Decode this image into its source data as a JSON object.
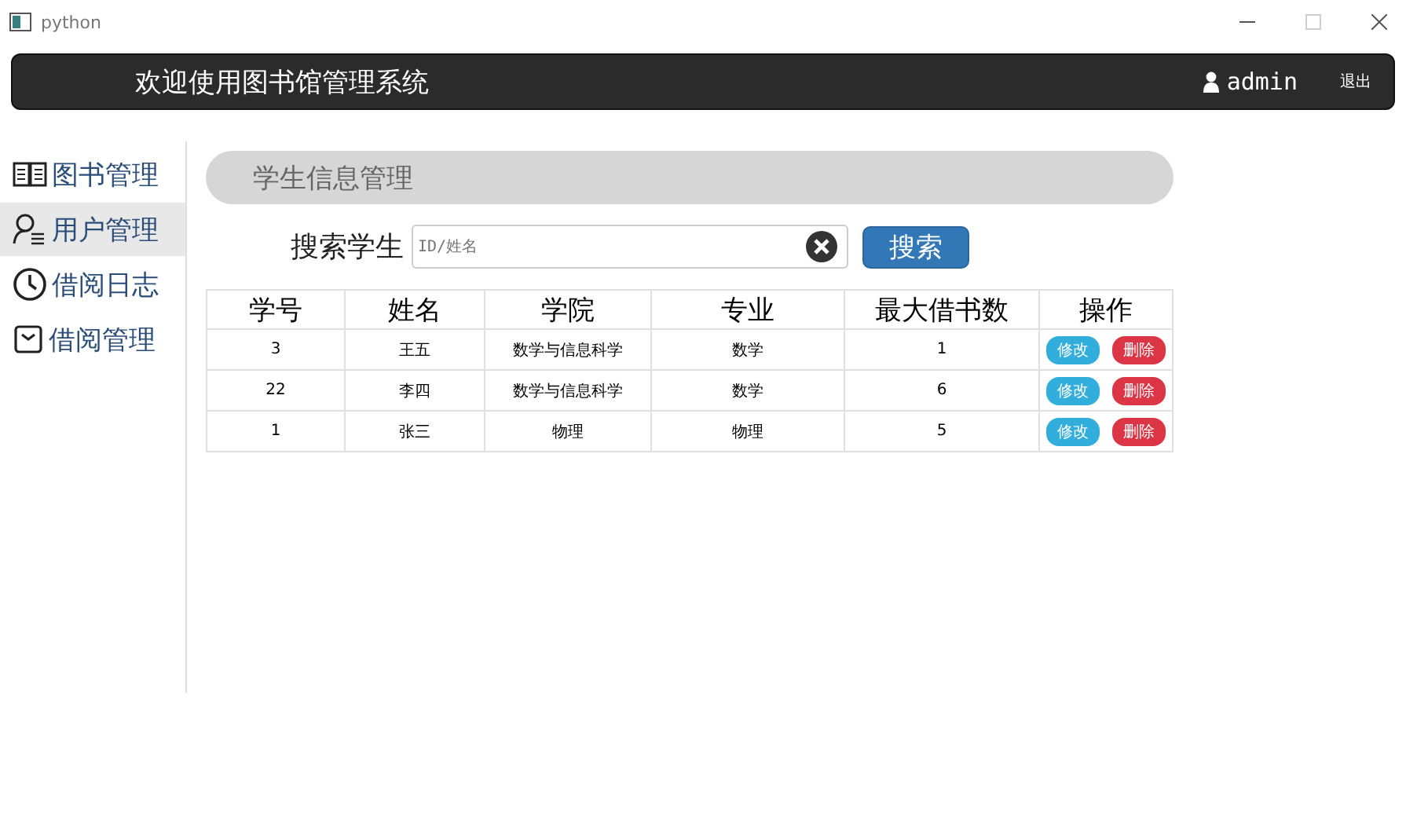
{
  "window": {
    "title": "python"
  },
  "header": {
    "title": "欢迎使用图书馆管理系统",
    "user": "admin",
    "logout": "退出"
  },
  "sidebar": {
    "items": [
      {
        "kind": "book",
        "label": "图书管理",
        "selected": false
      },
      {
        "kind": "user",
        "label": "用户管理",
        "selected": true
      },
      {
        "kind": "clock",
        "label": "借阅日志",
        "selected": false
      },
      {
        "kind": "tray",
        "label": "借阅管理",
        "selected": false
      }
    ]
  },
  "panel": {
    "title": "学生信息管理"
  },
  "search": {
    "label": "搜索学生",
    "placeholder": "ID/姓名",
    "button": "搜索"
  },
  "table": {
    "columns": [
      "学号",
      "姓名",
      "学院",
      "专业",
      "最大借书数",
      "操作"
    ],
    "rows": [
      {
        "cells": [
          "3",
          "王五",
          "数学与信息科学",
          "数学",
          "1"
        ],
        "edit": "修改",
        "delete": "删除"
      },
      {
        "cells": [
          "22",
          "李四",
          "数学与信息科学",
          "数学",
          "6"
        ],
        "edit": "修改",
        "delete": "删除"
      },
      {
        "cells": [
          "1",
          "张三",
          "物理",
          "物理",
          "5"
        ],
        "edit": "修改",
        "delete": "删除"
      }
    ]
  }
}
